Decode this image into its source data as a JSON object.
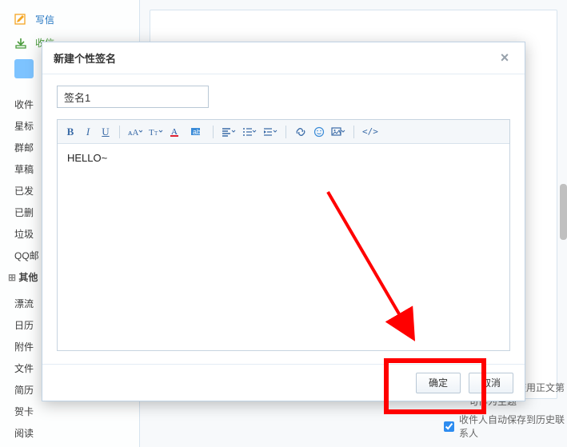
{
  "sidebar": {
    "compose": {
      "label": "写信"
    },
    "receive": {
      "label": "收信"
    },
    "folders": [
      "收件",
      "星标",
      "群邮",
      "草稿",
      "已发",
      "已删",
      "垃圾",
      "QQ邮"
    ],
    "other_header": "其他",
    "others": [
      "漂流",
      "日历",
      "附件",
      "文件",
      "简历",
      "贺卡",
      "阅读"
    ]
  },
  "bottom": {
    "subject_hint": "未填主题时，使用正文第一句作为主题",
    "auto_save": "收件人自动保存到历史联系人"
  },
  "dialog": {
    "title": "新建个性签名",
    "name_value": "签名1",
    "editor_content": "HELLO~",
    "ok": "确定",
    "cancel": "取消"
  },
  "toolbar": {
    "bold": "B",
    "italic": "I",
    "underline": "U",
    "source": "</>"
  }
}
